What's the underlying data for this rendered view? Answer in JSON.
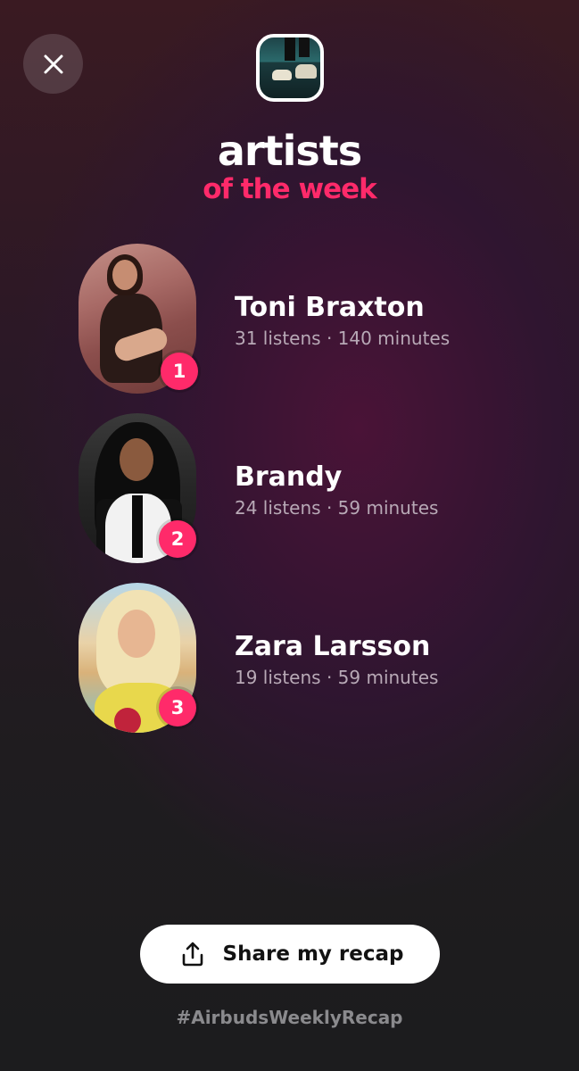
{
  "header": {
    "close_icon": "close-icon",
    "app_thumbnail": "sneakers-thumbnail"
  },
  "title": {
    "main": "artists",
    "sub": "of the week",
    "sub_color": "#ff2a6a"
  },
  "artists": [
    {
      "rank": "1",
      "name": "Toni Braxton",
      "stats": "31 listens · 140 minutes"
    },
    {
      "rank": "2",
      "name": "Brandy",
      "stats": "24 listens · 59 minutes"
    },
    {
      "rank": "3",
      "name": "Zara Larsson",
      "stats": "19 listens · 59 minutes"
    }
  ],
  "share": {
    "label": "Share my recap",
    "icon": "share-icon"
  },
  "hashtag": "#AirbudsWeeklyRecap",
  "colors": {
    "accent": "#ff2a6a",
    "button_bg": "#ffffff",
    "muted_text": "#b8a9b6"
  }
}
